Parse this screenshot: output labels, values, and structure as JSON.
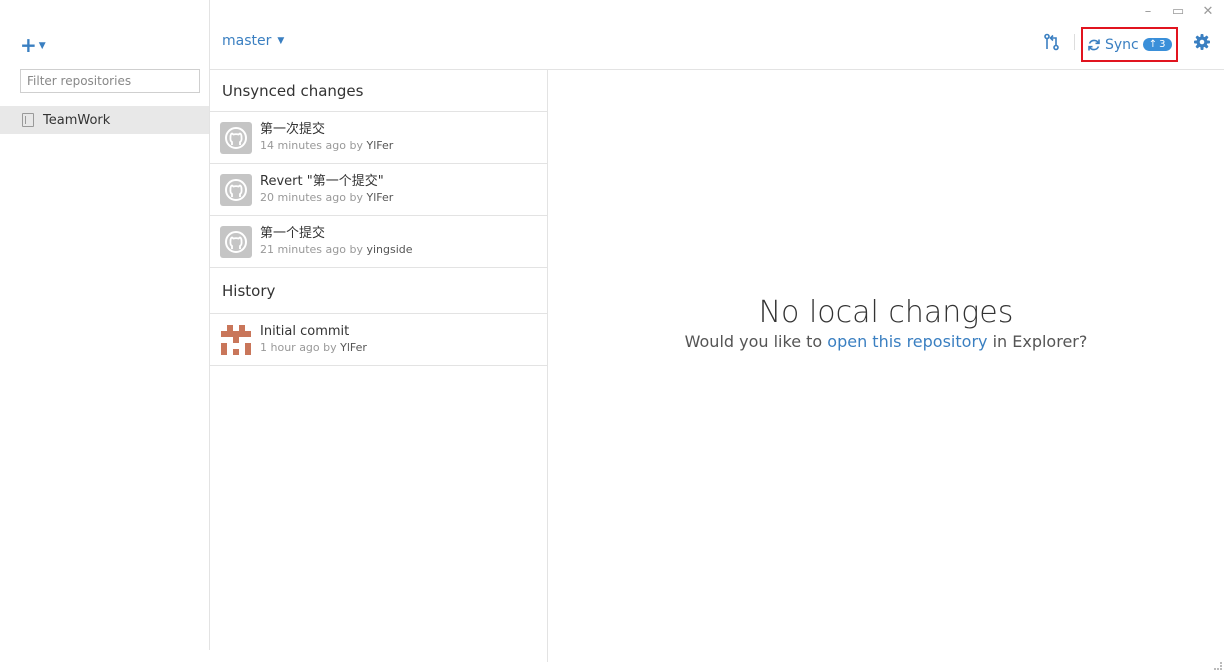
{
  "window": {
    "minimize": "–",
    "maximize": "▭",
    "close": "✕"
  },
  "sidebar": {
    "add_label": "+",
    "filter_placeholder": "Filter repositories",
    "repos": [
      {
        "name": "TeamWork"
      }
    ]
  },
  "topbar": {
    "branch": "master",
    "sync_label": "Sync",
    "sync_count": "3"
  },
  "changes": {
    "unsynced_title": "Unsynced changes",
    "unsynced": [
      {
        "message": "第一次提交",
        "time": "14 minutes ago",
        "by": "by",
        "author": "YlFer"
      },
      {
        "message": "Revert \"第一个提交\"",
        "time": "20 minutes ago",
        "by": "by",
        "author": "YlFer"
      },
      {
        "message": "第一个提交",
        "time": "21 minutes ago",
        "by": "by",
        "author": "yingside"
      }
    ],
    "history_title": "History",
    "history": [
      {
        "message": "Initial commit",
        "time": "1 hour ago",
        "by": "by",
        "author": "YlFer"
      }
    ]
  },
  "main": {
    "title": "No local changes",
    "sub_prefix": "Would you like to ",
    "sub_link": "open this repository",
    "sub_suffix": " in Explorer?"
  },
  "colors": {
    "accent": "#3a7fc1",
    "highlight": "#e1141f",
    "badge": "#3a8fd9"
  }
}
